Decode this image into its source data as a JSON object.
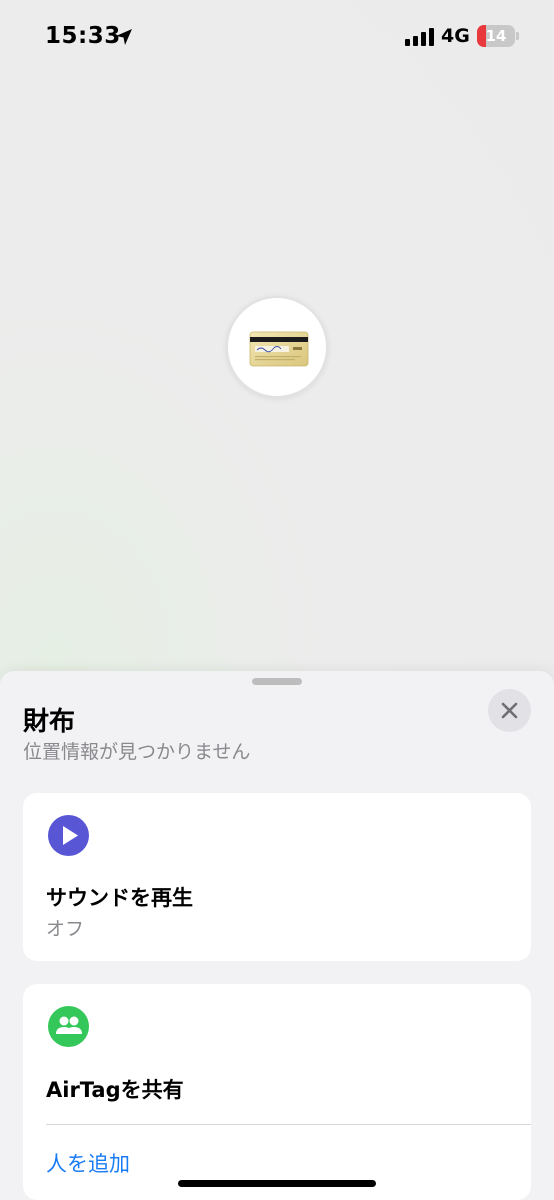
{
  "status_bar": {
    "time": "15:33",
    "network": "4G",
    "battery_level": "14",
    "battery_color": "#e8393c"
  },
  "map": {
    "pin_icon": "credit-card-icon"
  },
  "sheet": {
    "title": "財布",
    "subtitle": "位置情報が見つかりません",
    "close_icon": "close-icon",
    "play_sound": {
      "icon": "play-icon",
      "icon_color": "#5956d6",
      "title": "サウンドを再生",
      "status": "オフ"
    },
    "share": {
      "icon": "people-icon",
      "icon_color": "#34c759",
      "title": "AirTagを共有",
      "add_person_label": "人を追加",
      "link_color": "#1a7cf5"
    }
  }
}
